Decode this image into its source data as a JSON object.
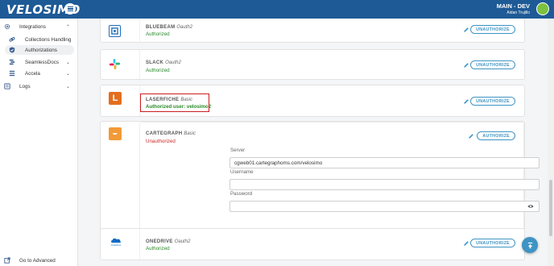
{
  "header": {
    "logo_text": "VELOSIMO",
    "environment": "MAIN - DEV",
    "user": "Aidan Trujillo"
  },
  "sidebar": {
    "items": [
      {
        "label": "Integrations",
        "icon": "gear-icon",
        "expanded": true
      },
      {
        "label": "Collections Handling",
        "icon": "link-icon"
      },
      {
        "label": "Authorizations",
        "icon": "shield-check-icon",
        "active": true
      },
      {
        "label": "SeamlessDocs",
        "icon": "docs-icon"
      },
      {
        "label": "Accela",
        "icon": "list-icon"
      },
      {
        "label": "Logs",
        "icon": "logs-icon"
      }
    ],
    "footer": {
      "label": "Go to Advanced",
      "icon": "external-link-icon"
    }
  },
  "connectors": [
    {
      "name": "BLUEBEAM",
      "auth_type": "Oauth2",
      "status": "Authorized",
      "action": "UNAUTHORIZE",
      "logo_color": "#1f6fb8"
    },
    {
      "name": "SLACK",
      "auth_type": "Oauth2",
      "status": "Authorized",
      "action": "UNAUTHORIZE",
      "logo_color": "#611f69"
    },
    {
      "name": "LASERFICHE",
      "auth_type": "Basic",
      "status": "Authorized user: velosimo2",
      "action": "UNAUTHORIZE",
      "logo_color": "#e36f1e",
      "logo_letter": "L"
    },
    {
      "name": "CARTEGRAPH",
      "auth_type": "Basic",
      "status": "Unauthorized",
      "action": "AUTHORIZE",
      "logo_color": "#f29a38",
      "form": {
        "server_label": "Server",
        "server_value": "cgweb01.cartegraphoms.com/velosimo",
        "username_label": "Username",
        "username_value": "",
        "password_label": "Password",
        "password_value": ""
      }
    },
    {
      "name": "ONEDRIVE",
      "auth_type": "Oauth2",
      "status": "Authorized",
      "action": "UNAUTHORIZE",
      "logo_color": "#0a6bc4",
      "logo_caption": "OneDrive"
    }
  ],
  "colors": {
    "header": "#1e5a96",
    "accent": "#3e94c4",
    "authorized": "#2a8a2a",
    "unauthorized": "#cc2a2a",
    "highlight": "#cc1f1f"
  }
}
